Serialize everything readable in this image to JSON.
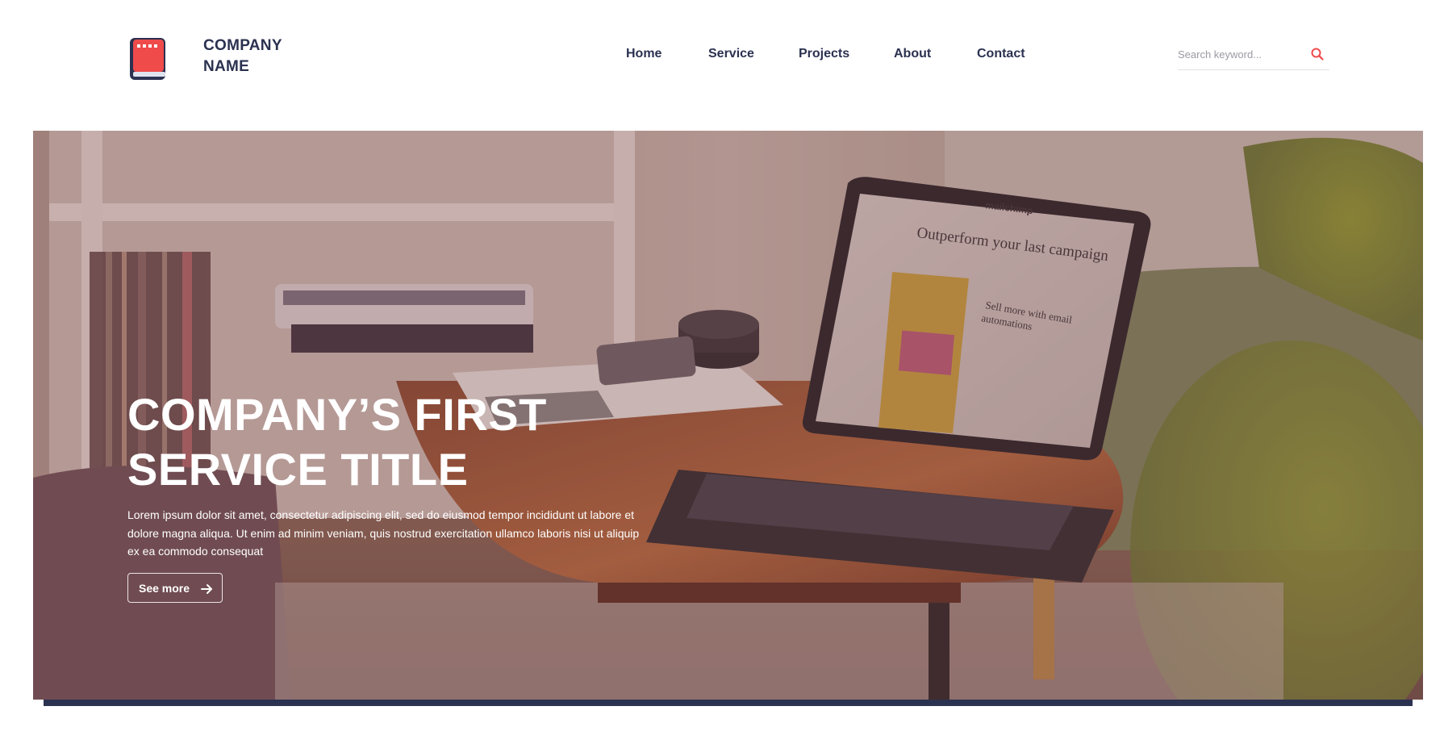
{
  "header": {
    "company_name_line1": "COMPANY",
    "company_name_line2": "NAME",
    "logo_icon": "book-icon"
  },
  "nav": {
    "items": [
      {
        "label": "Home"
      },
      {
        "label": "Service"
      },
      {
        "label": "Projects"
      },
      {
        "label": "About"
      },
      {
        "label": "Contact"
      }
    ]
  },
  "search": {
    "placeholder": "Search keyword...",
    "icon": "search-icon"
  },
  "hero": {
    "title_line1": "COMPANY’S FIRST",
    "title_line2": "SERVICE TITLE",
    "description": "Lorem ipsum dolor sit amet, consectetur adipiscing elit, sed do eiusmod tempor incididunt ut labore et dolore magna aliqua. Ut enim ad minim veniam, quis nostrud exercitation ullamco laboris nisi ut aliquip ex ea commodo consequat",
    "button_label": "See more",
    "button_icon": "arrow-right-icon",
    "laptop_screen": {
      "brand": "mailchimp",
      "headline": "Outperform your last campaign",
      "subhead": "Sell more with email automations",
      "cta": "Sell more"
    }
  },
  "colors": {
    "brand_navy": "#2b3150",
    "accent_red": "#ef4b4b",
    "hero_overlay": "#783c46"
  }
}
